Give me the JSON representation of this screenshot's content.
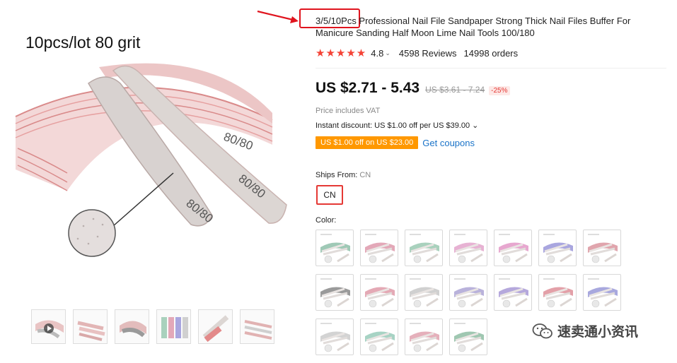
{
  "main_image": {
    "caption": "10pcs/lot  80 grit",
    "grit_label": "80/80"
  },
  "thumbnails": [
    {
      "icon": "video-thumbnail",
      "has_play": true
    },
    {
      "icon": "nail-file-thumbnail"
    },
    {
      "icon": "nail-file-thumbnail"
    },
    {
      "icon": "nail-file-thumbnail"
    },
    {
      "icon": "nail-file-thumbnail"
    },
    {
      "icon": "nail-file-thumbnail"
    }
  ],
  "product": {
    "title": "3/5/10Pcs Professional Nail File Sandpaper Strong Thick Nail Files Buffer For Manicure Sanding Half Moon Lime Nail Tools 100/180",
    "stars": "★★★★★",
    "rating": "4.8",
    "rating_chevron": "⌄",
    "reviews": "4598 Reviews",
    "orders": "14998 orders",
    "price": "US $2.71 - 5.43",
    "old_price": "US $3.61 - 7.24",
    "discount": "-25%",
    "vat_note": "Price includes VAT",
    "instant_discount": "Instant discount: US $1.00 off per US $39.00 ⌄",
    "coupon_badge": "US $1.00 off on US $23.00",
    "get_coupons": "Get coupons",
    "ships_from_label": "Ships From: ",
    "ships_from_value": "CN",
    "ship_option": "CN",
    "color_label": "Color:"
  },
  "colors": {
    "accent_red": "#e53935",
    "star_red": "#f44336",
    "coupon_orange": "#ff9800",
    "link_blue": "#1a73c8",
    "highlight_red": "#e0141e"
  },
  "swatches": [
    {
      "tone": "#9fc9b6"
    },
    {
      "tone": "#e3a8b8"
    },
    {
      "tone": "#a9d1bd"
    },
    {
      "tone": "#e7b2d3"
    },
    {
      "tone": "#e7a7cf"
    },
    {
      "tone": "#a9a6df"
    },
    {
      "tone": "#e0a5ad"
    },
    {
      "tone": "#9a9a9a"
    },
    {
      "tone": "#e4a9b5"
    },
    {
      "tone": "#d0d0d0"
    },
    {
      "tone": "#b9b2db"
    },
    {
      "tone": "#b5a8dc"
    },
    {
      "tone": "#e3a0a8"
    },
    {
      "tone": "#a8a8de"
    },
    {
      "tone": "#d3d3d3"
    },
    {
      "tone": "#a7d3c4"
    },
    {
      "tone": "#e5b0bb"
    },
    {
      "tone": "#9fc7b1"
    }
  ],
  "watermark": {
    "text": "速卖通小资讯"
  }
}
